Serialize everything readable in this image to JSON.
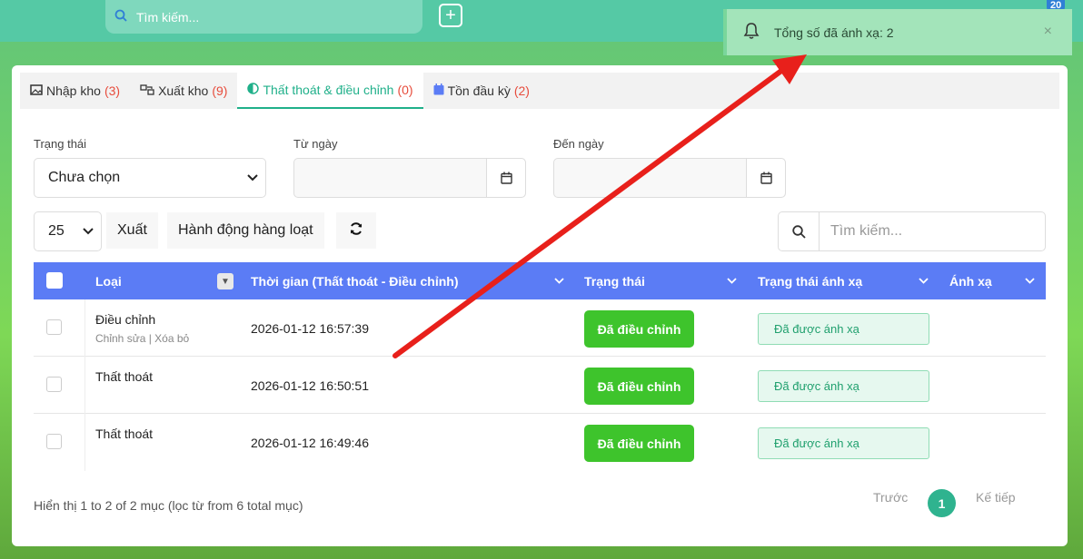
{
  "topbar": {
    "search_placeholder": "Tìm kiếm...",
    "plus": "+",
    "notif_count": "20"
  },
  "toast": {
    "message": "Tổng số đã ánh xạ: 2",
    "close": "×"
  },
  "tabs": [
    {
      "label": "Nhập kho",
      "count": "(3)"
    },
    {
      "label": "Xuất kho",
      "count": "(9)"
    },
    {
      "label": "Thất thoát & điều chỉnh",
      "count": "(0)"
    },
    {
      "label": "Tồn đầu kỳ",
      "count": "(2)"
    }
  ],
  "filters": {
    "status_label": "Trạng thái",
    "status_value": "Chưa chọn",
    "from_label": "Từ ngày",
    "to_label": "Đến ngày"
  },
  "toolbar": {
    "page_size": "25",
    "export": "Xuất",
    "bulk": "Hành động hàng loạt",
    "search_placeholder": "Tìm kiếm..."
  },
  "table": {
    "headers": [
      "Loại",
      "Thời gian (Thất thoát - Điều chỉnh)",
      "Trạng thái",
      "Trạng thái ánh xạ",
      "Ánh xạ"
    ],
    "rows": [
      {
        "type": "Điều chỉnh",
        "sub": "Chỉnh sửa | Xóa bỏ",
        "time": "2026-01-12 16:57:39",
        "status": "Đã điều chỉnh",
        "map": "Đã được ánh xạ"
      },
      {
        "type": "Thất thoát",
        "sub": "",
        "time": "2026-01-12 16:50:51",
        "status": "Đã điều chỉnh",
        "map": "Đã được ánh xạ"
      },
      {
        "type": "Thất thoát",
        "sub": "",
        "time": "2026-01-12 16:49:46",
        "status": "Đã điều chỉnh",
        "map": "Đã được ánh xạ"
      }
    ]
  },
  "footer": {
    "info": "Hiển thị 1 to 2 of 2 mục (lọc từ from 6 total mục)",
    "prev": "Trước",
    "page": "1",
    "next": "Kế tiếp"
  },
  "colors": {
    "accent": "#20b08a",
    "header": "#5b7cf5",
    "status": "#3ec42c",
    "annotation": "#e8201b"
  }
}
